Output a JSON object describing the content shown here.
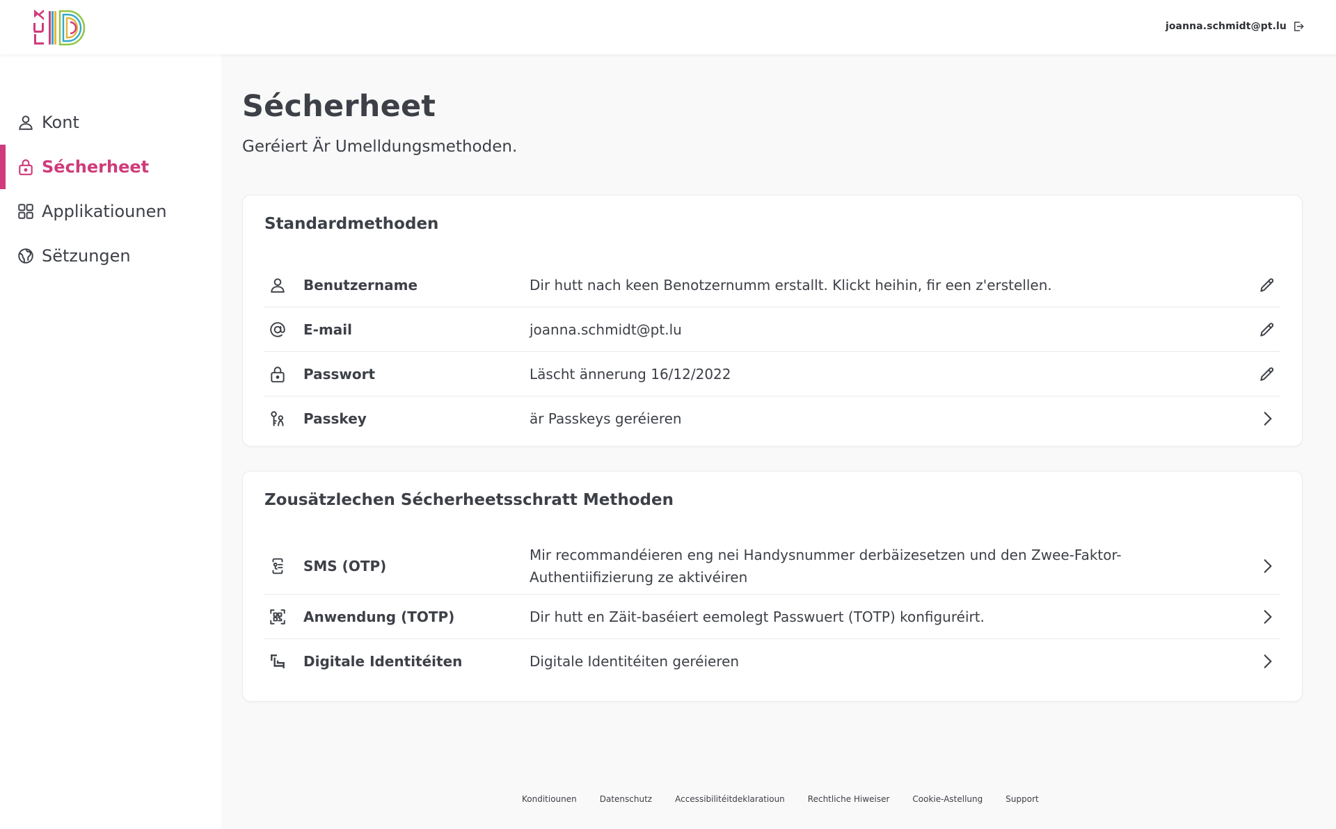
{
  "brand": {
    "logo_text": "LUXID",
    "colors": {
      "accent": "#cf3b7b",
      "text": "#3d4047",
      "background": "#f9f9f9"
    }
  },
  "header": {
    "user_email": "joanna.schmidt@pt.lu",
    "logout_icon": "logout-icon"
  },
  "sidebar": {
    "items": [
      {
        "label": "Kont",
        "icon": "user-icon",
        "active": false
      },
      {
        "label": "Sécherheet",
        "icon": "lock-icon",
        "active": true
      },
      {
        "label": "Applikatiounen",
        "icon": "grid-icon",
        "active": false
      },
      {
        "label": "Sëtzungen",
        "icon": "globe-icon",
        "active": false
      }
    ]
  },
  "main": {
    "title": "Sécherheet",
    "subtitle": "Geréiert Är Umelldungsmethoden."
  },
  "standard_methods": {
    "title": "Standardmethoden",
    "rows": [
      {
        "label": "Benutzername",
        "value": "Dir hutt nach keen Benotzernumm erstallt. Klickt heihin, fir een z'erstellen.",
        "icon": "user-icon",
        "action": "edit-icon"
      },
      {
        "label": "E-mail",
        "value": "joanna.schmidt@pt.lu",
        "icon": "at-icon",
        "action": "edit-icon"
      },
      {
        "label": "Passwort",
        "value": "Läscht ännerung 16/12/2022",
        "icon": "lock-icon",
        "action": "edit-icon"
      },
      {
        "label": "Passkey",
        "value": "är Passkeys geréieren",
        "icon": "passkey-icon",
        "action": "chevron-right-icon"
      }
    ]
  },
  "additional_methods": {
    "title": "Zousätzlechen Sécherheetsschratt Methoden",
    "rows": [
      {
        "label": "SMS (OTP)",
        "value": "Mir recommandéieren eng nei Handysnummer derbäizesetzen und den Zwee-Faktor-Authentiifizierung ze aktivéiren",
        "icon": "phone-otp-icon",
        "action": "chevron-right-icon"
      },
      {
        "label": "Anwendung (TOTP)",
        "value": "Dir hutt en Zäit-baséiert eemolegt Passwuert (TOTP) konfiguréirt.",
        "icon": "qr-scan-icon",
        "action": "chevron-right-icon"
      },
      {
        "label": "Digitale Identitéiten",
        "value": "Digitale Identitéiten geréieren",
        "icon": "digital-id-icon",
        "action": "chevron-right-icon"
      }
    ]
  },
  "footer": {
    "links": [
      "Konditiounen",
      "Datenschutz",
      "Accessibilitéitdeklaratioun",
      "Rechtliche Hiweiser",
      "Cookie-Astellung",
      "Support"
    ]
  }
}
